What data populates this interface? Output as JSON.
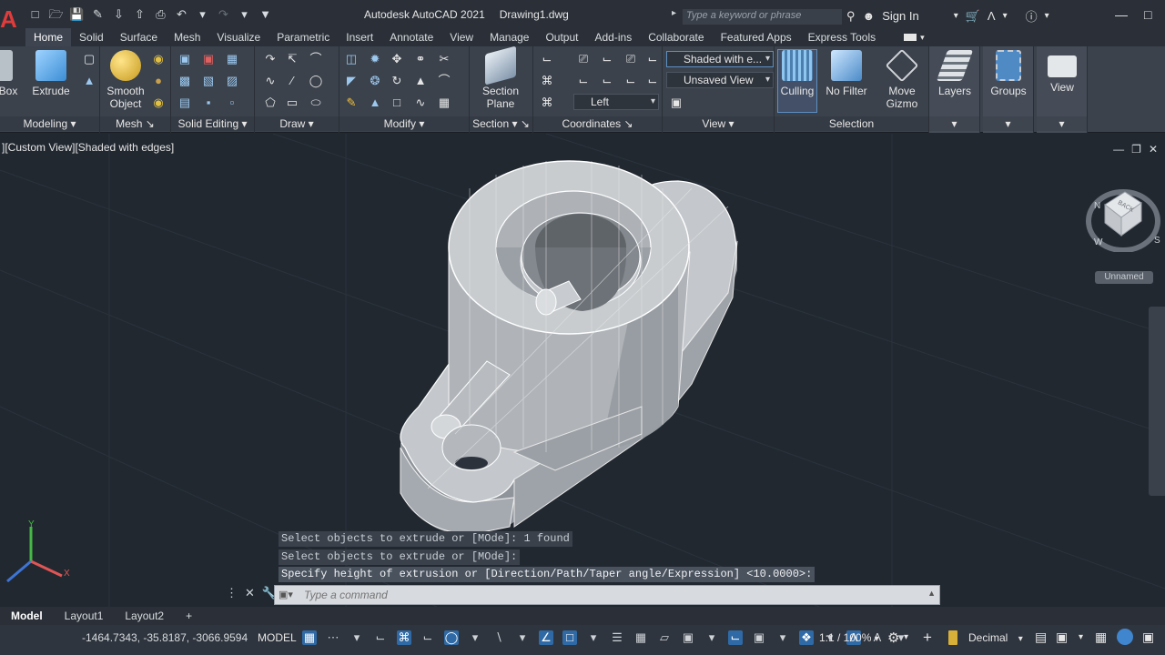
{
  "app": {
    "title": "Autodesk AutoCAD 2021",
    "file": "Drawing1.dwg",
    "logo": "A",
    "search_placeholder": "Type a keyword or phrase",
    "sign_in": "Sign In"
  },
  "tabs": [
    "Home",
    "Solid",
    "Surface",
    "Mesh",
    "Visualize",
    "Parametric",
    "Insert",
    "Annotate",
    "View",
    "Manage",
    "Output",
    "Add-ins",
    "Collaborate",
    "Featured Apps",
    "Express Tools"
  ],
  "active_tab": "Home",
  "ribbon": {
    "box_label": "Box",
    "extrude_label": "Extrude",
    "smooth_object_label1": "Smooth",
    "smooth_object_label2": "Object",
    "section_plane_label1": "Section",
    "section_plane_label2": "Plane",
    "visual_style": "Shaded with e...",
    "view_name": "Unsaved View",
    "ucs_view": "Left",
    "culling_label": "Culling",
    "no_filter_label": "No Filter",
    "move_gizmo_label1": "Move",
    "move_gizmo_label2": "Gizmo",
    "layers_label": "Layers",
    "groups_label": "Groups",
    "view_label": "View",
    "panels": {
      "modeling": "Modeling",
      "mesh": "Mesh",
      "solid_editing": "Solid Editing",
      "draw": "Draw",
      "modify": "Modify",
      "section": "Section",
      "coordinates": "Coordinates",
      "view": "View",
      "selection": "Selection"
    }
  },
  "viewport": {
    "label": "][Custom View][Shaded with edges]",
    "viewcube_label": "Unnamed",
    "compass_n": "N",
    "compass_w": "W",
    "compass_s": "S",
    "cube_face": "BACK"
  },
  "command": {
    "history": [
      "Select objects to extrude or [MOde]: 1 found",
      "Select objects to extrude or [MOde]:",
      "Specify height of extrusion or [Direction/Path/Taper angle/Expression] <10.0000>:"
    ],
    "placeholder": "Type a command"
  },
  "layout_tabs": [
    "Model",
    "Layout1",
    "Layout2"
  ],
  "status": {
    "coords": "-1464.7343, -35.8187, -3066.9594",
    "model": "MODEL",
    "scale": "1:1 / 100%",
    "units": "Decimal"
  }
}
